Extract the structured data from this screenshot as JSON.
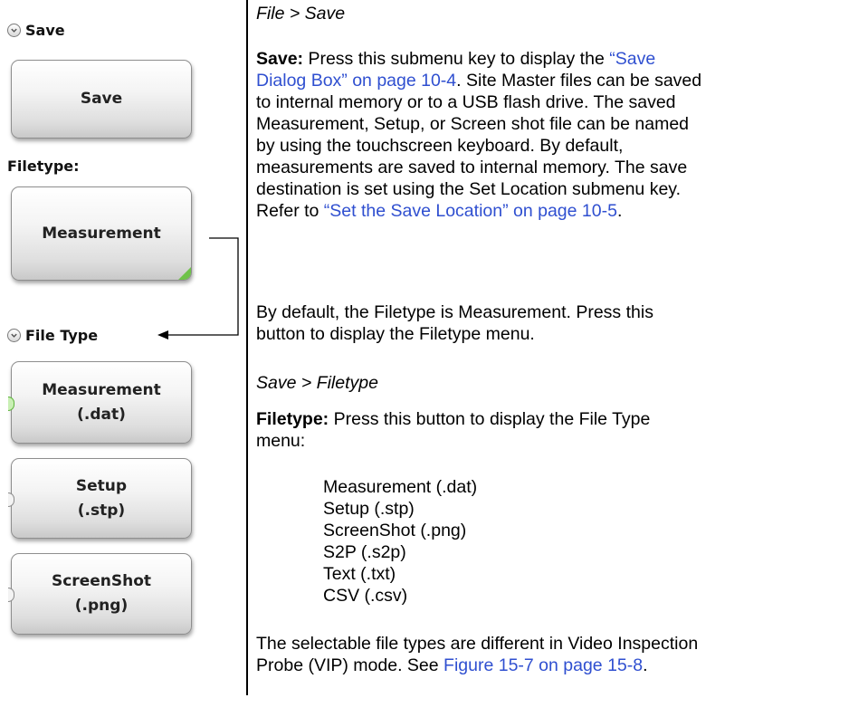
{
  "left": {
    "save_menu_title": "Save",
    "save_key": "Save",
    "filetype_label": "Filetype:",
    "filetype_key": "Measurement",
    "file_type_menu_title": "File Type",
    "keys": [
      {
        "line1": "Measurement",
        "line2": "(.dat)",
        "active": true
      },
      {
        "line1": "Setup",
        "line2": "(.stp)",
        "active": false
      },
      {
        "line1": "ScreenShot",
        "line2": "(.png)",
        "active": false
      }
    ]
  },
  "right": {
    "path1": "File > Save",
    "save_term": "Save:",
    "save_pre": "  Press this submenu key to display the ",
    "save_link1_a": "“Save",
    "save_link1_b": "Dialog Box” on page 10-4",
    "save_l3_post": ". Site Master files can be saved",
    "save_l4": "to internal memory or to a USB flash drive. The saved",
    "save_l5": "Measurement, Setup, or Screen shot file can be named",
    "save_l6": "by using the touchscreen keyboard. By default,",
    "save_l7": "measurements are saved to internal memory. The save",
    "save_l8": "destination is set using the Set Location submenu key.",
    "save_l9_pre": "Refer to ",
    "save_l9_link": "“Set the Save Location” on page 10-5",
    "save_l9_post": ".",
    "default_l1": "By default, the Filetype is Measurement. Press this",
    "default_l2": "button to display the Filetype menu.",
    "path2": "Save > Filetype",
    "filetype_term": "Filetype:",
    "filetype_l1_post": "  Press this button to display the File Type",
    "filetype_l2": "menu:",
    "list": [
      "Measurement (.dat)",
      "Setup (.stp)",
      "ScreenShot (.png)",
      "S2P (.s2p)",
      "Text (.txt)",
      "CSV (.csv)"
    ],
    "vip_l1": "The selectable file types are different in Video Inspection",
    "vip_l2_pre": "Probe (VIP) mode. See ",
    "vip_l2_link": "Figure 15-7 on page 15-8",
    "vip_l2_post": "."
  }
}
